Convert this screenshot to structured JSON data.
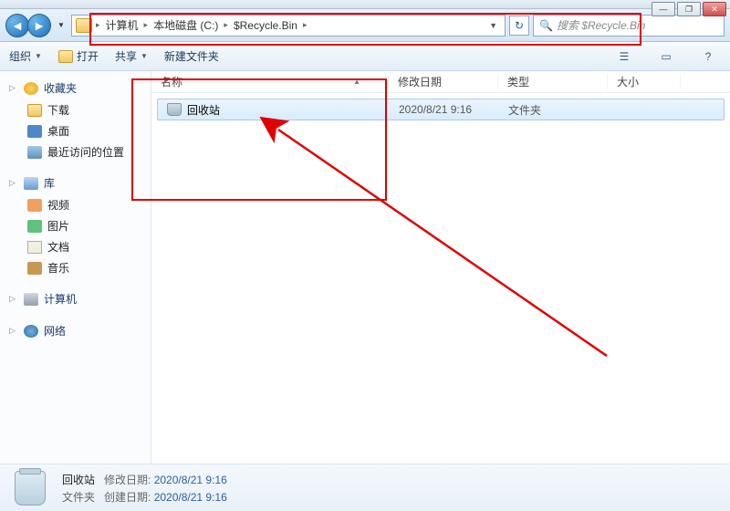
{
  "window_controls": {
    "min": "—",
    "max": "❐",
    "close": "✕"
  },
  "nav": {
    "back": "◄",
    "forward": "►",
    "dropdown": "▼",
    "refresh": "↻"
  },
  "breadcrumbs": {
    "sep": "▸",
    "items": [
      "计算机",
      "本地磁盘 (C:)",
      "$Recycle.Bin"
    ]
  },
  "search": {
    "placeholder": "搜索 $Recycle.Bin",
    "icon": "🔍"
  },
  "toolbar": {
    "organize": "组织",
    "open": "打开",
    "share": "共享",
    "newfolder": "新建文件夹",
    "dd": "▼",
    "view_icon": "☰",
    "preview_icon": "▭",
    "help_icon": "?"
  },
  "columns": {
    "name": "名称",
    "date": "修改日期",
    "type": "类型",
    "size": "大小",
    "sort": "▲"
  },
  "sidebar": {
    "favorites": {
      "label": "收藏夹",
      "toggle": "▷",
      "items": [
        "下载",
        "桌面",
        "最近访问的位置"
      ]
    },
    "libraries": {
      "label": "库",
      "toggle": "▷",
      "items": [
        "视频",
        "图片",
        "文档",
        "音乐"
      ]
    },
    "computer": {
      "label": "计算机",
      "toggle": "▷"
    },
    "network": {
      "label": "网络",
      "toggle": "▷"
    }
  },
  "files": [
    {
      "name": "回收站",
      "date": "2020/8/21 9:16",
      "type": "文件夹"
    }
  ],
  "details": {
    "name": "回收站",
    "type": "文件夹",
    "mod_label": "修改日期:",
    "mod_value": "2020/8/21 9:16",
    "create_label": "创建日期:",
    "create_value": "2020/8/21 9:16"
  }
}
